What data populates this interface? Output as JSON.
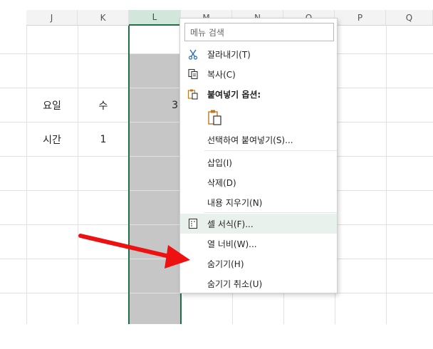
{
  "columns": [
    {
      "key": "J",
      "label": "J"
    },
    {
      "key": "K",
      "label": "K"
    },
    {
      "key": "L",
      "label": "L"
    },
    {
      "key": "M",
      "label": "M"
    },
    {
      "key": "N",
      "label": "N"
    },
    {
      "key": "O",
      "label": "O"
    },
    {
      "key": "P",
      "label": "P"
    },
    {
      "key": "Q",
      "label": "Q"
    }
  ],
  "cells": {
    "j_row1": "요일",
    "k_row1": "수",
    "l_row1_partial": "3",
    "j_row2": "시간",
    "k_row2": "1"
  },
  "menu": {
    "search_placeholder": "메뉴 검색",
    "items": [
      {
        "label": "잘라내기(T)",
        "icon": "scissors-icon"
      },
      {
        "label": "복사(C)",
        "icon": "copy-icon"
      },
      {
        "label": "붙여넣기 옵션:",
        "icon": "clipboard-icon"
      },
      {
        "label": "",
        "icon": "paste-clipboard-icon"
      },
      {
        "label": "선택하여 붙여넣기(S)...",
        "icon": ""
      },
      {
        "label": "삽입(I)",
        "icon": ""
      },
      {
        "label": "삭제(D)",
        "icon": ""
      },
      {
        "label": "내용 지우기(N)",
        "icon": ""
      },
      {
        "label": "셀 서식(F)...",
        "icon": "format-cells-icon"
      },
      {
        "label": "열 너비(W)...",
        "icon": ""
      },
      {
        "label": "숨기기(H)",
        "icon": ""
      },
      {
        "label": "숨기기 취소(U)",
        "icon": ""
      }
    ]
  },
  "colors": {
    "selection_green": "#1e7145",
    "selected_fill": "#c6c6c6",
    "arrow_red": "#ee1111"
  }
}
